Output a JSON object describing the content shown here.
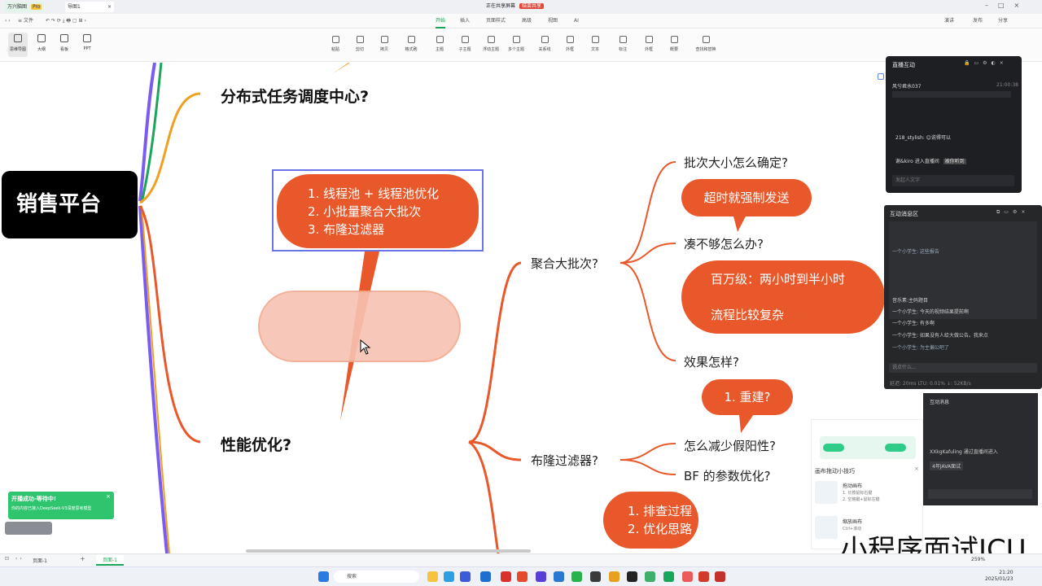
{
  "tabs": {
    "app_name": "万兴脑图",
    "pro_badge": "Pro",
    "doc_tab": "导图1",
    "share_banner": "正在共享屏幕",
    "stop_share": "结束共享"
  },
  "titlebar": {
    "file_label": "文件",
    "menus": [
      "开始",
      "插入",
      "页面样式",
      "高级",
      "视图",
      "AI"
    ],
    "right": [
      "演讲",
      "发布",
      "分享"
    ]
  },
  "view_tools": [
    "思维导图",
    "大纲",
    "看板",
    "PPT"
  ],
  "toolbar_items": [
    "粘贴",
    "剪切",
    "拷贝",
    "格式刷",
    "主题",
    "子主题",
    "浮动主题",
    "多个主题",
    "关系线",
    "外框",
    "文本",
    "标注",
    "外框",
    "概要",
    "查找和替换"
  ],
  "mindmap": {
    "root": "销售平台",
    "topic1": "分布式任务调度中心?",
    "topic2": "性能优化?",
    "box_lines": [
      "1. 线程池 + 线程池优化",
      "2. 小批量聚合大批次",
      "3. 布隆过滤器"
    ],
    "branch_batch": "聚合大批次?",
    "branch_bloom": "布隆过滤器?",
    "q_size": "批次大小怎么确定?",
    "a_timeout": "超时就强制发送",
    "q_notenough": "凑不够怎么办?",
    "a_result_lines": [
      "百万级：两小时到半小时",
      "流程比较复杂"
    ],
    "q_effect": "效果怎样?",
    "a_rebuild": "1. 重建?",
    "q_falsepos": "怎么减少假阳性?",
    "q_params": "BF 的参数优化?",
    "a_steps": [
      "1. 排查过程",
      "2. 优化思路"
    ]
  },
  "live": {
    "title": "直播互动",
    "user": "风兮君水037",
    "time": "21:00:38",
    "msg1": "218_stylish: 😊说得可以",
    "msg2": "谢&kiro 进入直播间",
    "msg2_tag": "被你听到",
    "input_placeholder": "发起人文字",
    "msg_title": "互动消息区",
    "msgs": [
      "一个小学生: 这些报告",
      "音乐素:主码题目",
      "一个小学生: 今天的视频结果提前啊",
      "一个小学生: 有多啊",
      "一个小学生: 如果没有人给大做公告。我来点",
      "一个小学生: 为主偏公吧了"
    ],
    "msg_input": "说点什么...",
    "stats": "延迟: 20ms   LTU: 0.01%   ↓: 52KB/s"
  },
  "tip": {
    "title": "画布拖动小技巧",
    "item1_title": "拖动画布",
    "item1_desc": "1. 长按鼠标右键\n2. 空格键+鼠标左键",
    "item2_title": "缩放画布",
    "item2_desc": "Ctrl+滚动"
  },
  "chat2": {
    "title": "互动消息",
    "line1": "XXkgKafuling 通过直播间进入",
    "line2": "4年JAVA面试"
  },
  "notice": {
    "text": "开播成功-等待中!",
    "sub": "你的内容已接入DeepSeek-V3深度思考模型"
  },
  "statusbar": {
    "page_label": "页面-1",
    "active_page": "页面-1",
    "zoom": "259%"
  },
  "taskbar": {
    "search": "搜索",
    "clock": "21:20",
    "date": "2025/01/23"
  },
  "watermark": "小程序面试ICU",
  "colors": {
    "accent": "#e9582a",
    "green": "#19a55a",
    "purple": "#7b5cf0",
    "orange_line": "#f0a020"
  }
}
